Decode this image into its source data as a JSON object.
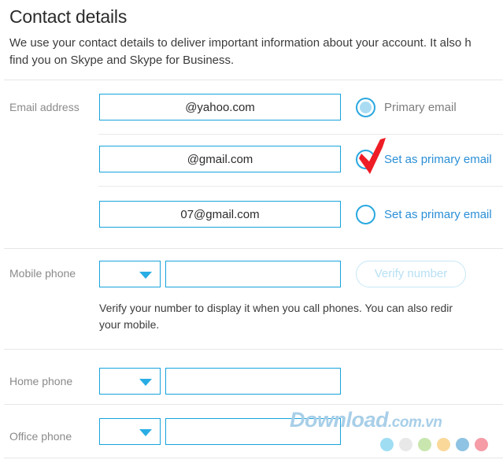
{
  "header": {
    "title": "Contact details",
    "intro": "We use your contact details to deliver important information about your account. It also h\nfind you on Skype and Skype for Business."
  },
  "fields": {
    "email_label": "Email address",
    "mobile_label": "Mobile phone",
    "home_label": "Home phone",
    "office_label": "Office phone"
  },
  "emails": [
    {
      "value": "@yahoo.com",
      "radio_label": "Primary email",
      "selected": true,
      "annotated": false
    },
    {
      "value": "@gmail.com",
      "radio_label": "Set as primary email",
      "selected": false,
      "annotated": true
    },
    {
      "value": "07@gmail.com",
      "radio_label": "Set as primary email",
      "selected": false,
      "annotated": false
    }
  ],
  "mobile": {
    "code_value": "",
    "number_value": "",
    "verify_button": "Verify number",
    "verify_disabled": true,
    "helper": "Verify your number to display it when you call phones. You can also redir\nyour mobile."
  },
  "home": {
    "code_value": "",
    "number_value": ""
  },
  "office": {
    "code_value": "",
    "number_value": ""
  },
  "watermark": {
    "name": "Download",
    "suffix": ".com.vn",
    "text_color": "#a8cfe8",
    "dots": [
      "#9fddf3",
      "#e8e8e8",
      "#c8e6ae",
      "#fad89a",
      "#8fc3e3",
      "#f59ca6"
    ]
  },
  "colors": {
    "accent": "#17a3dc",
    "link": "#2b8fd6",
    "annotation": "#ee1c25",
    "divider": "#e6e6e6"
  }
}
